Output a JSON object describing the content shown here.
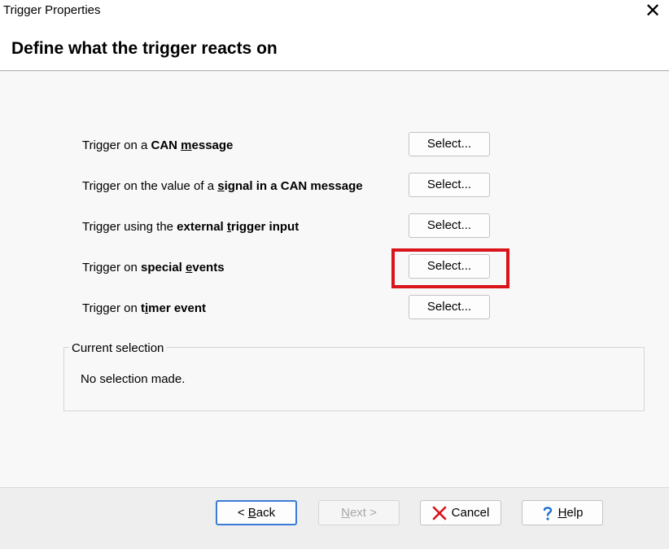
{
  "window": {
    "title": "Trigger Properties",
    "close_glyph": "✕"
  },
  "header": {
    "title": "Define what the trigger reacts on"
  },
  "options": [
    {
      "prefix": "Trigger on a ",
      "bold_pre": "CAN ",
      "mnemonic": "m",
      "bold_post": "essage",
      "button": "Select..."
    },
    {
      "prefix": "Trigger on the value of a ",
      "bold_pre": "",
      "mnemonic": "s",
      "bold_post": "ignal in a CAN message",
      "button": "Select..."
    },
    {
      "prefix": "Trigger using the ",
      "bold_pre": "external ",
      "mnemonic": "t",
      "bold_post": "rigger input",
      "button": "Select..."
    },
    {
      "prefix": "Trigger on ",
      "bold_pre": "special ",
      "mnemonic": "e",
      "bold_post": "vents",
      "button": "Select..."
    },
    {
      "prefix": "Trigger on ",
      "bold_pre": "t",
      "mnemonic": "i",
      "bold_post": "mer event",
      "button": "Select..."
    }
  ],
  "current_selection": {
    "legend": "Current selection",
    "text": "No selection made."
  },
  "footer": {
    "back": {
      "pre": "< ",
      "mnemonic": "B",
      "post": "ack"
    },
    "next": {
      "pre": "",
      "mnemonic": "N",
      "post": "ext >"
    },
    "cancel": {
      "label": "Cancel",
      "icon": "cancel-x-icon",
      "color": "#d9141b"
    },
    "help": {
      "mnemonic": "H",
      "post": "elp",
      "icon": "help-question-icon",
      "color": "#1a6fd1"
    }
  },
  "colors": {
    "highlight": "#d9141b",
    "default_button_border": "#3b7bd6"
  }
}
